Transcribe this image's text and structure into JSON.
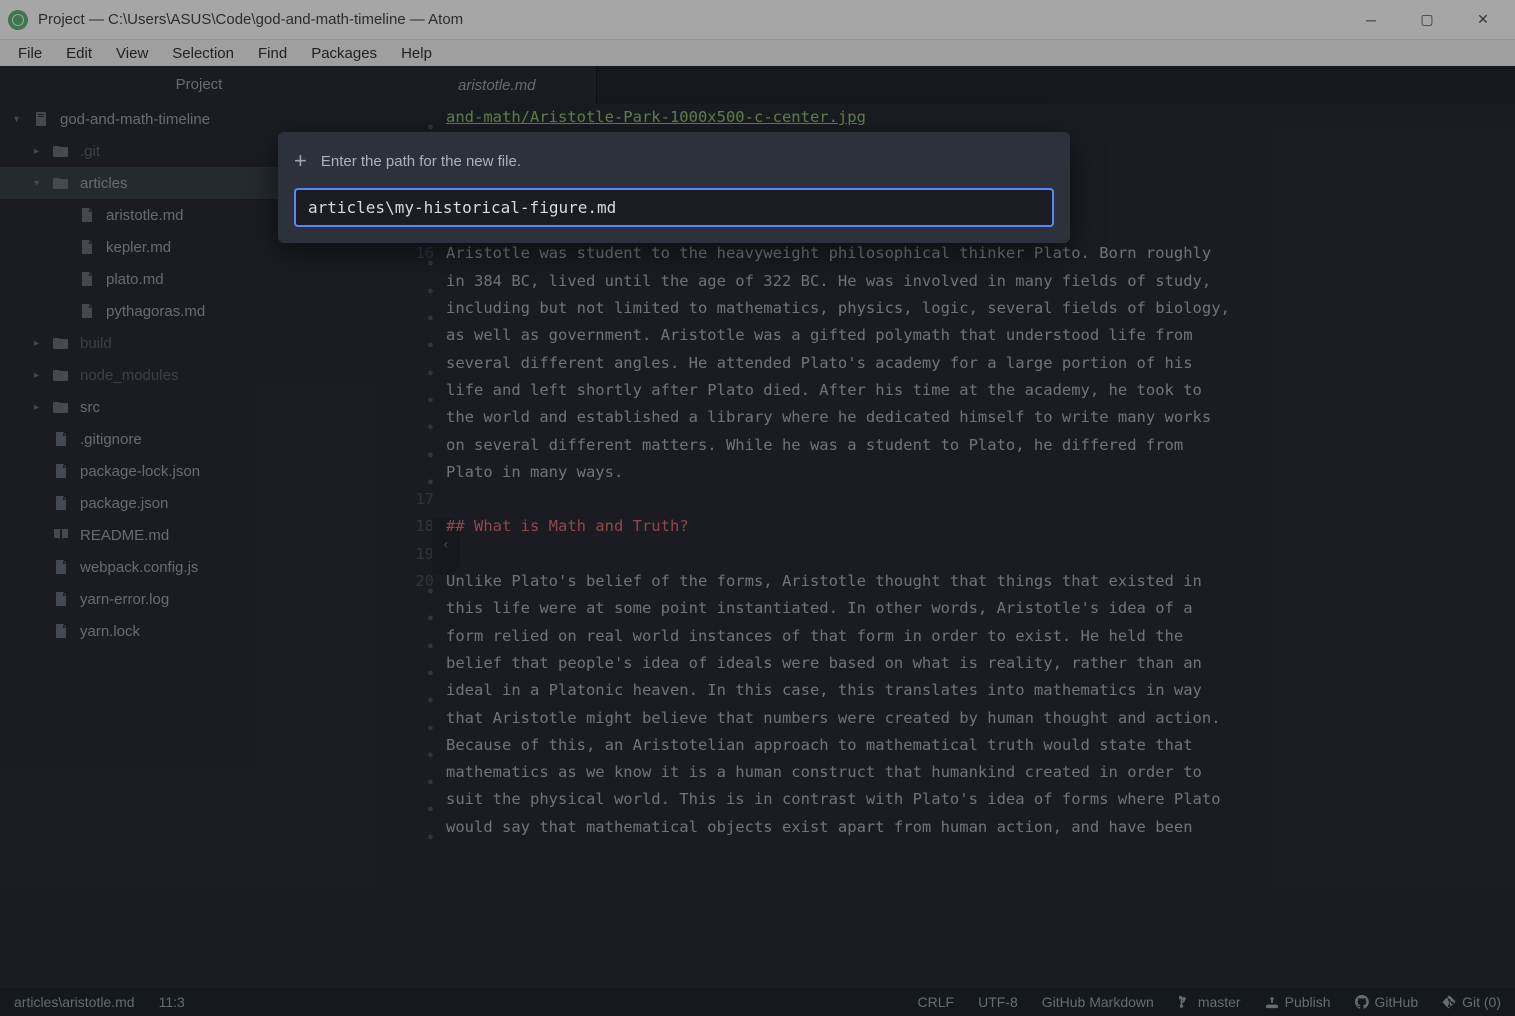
{
  "window": {
    "title": "Project — C:\\Users\\ASUS\\Code\\god-and-math-timeline — Atom"
  },
  "menu": [
    "File",
    "Edit",
    "View",
    "Selection",
    "Find",
    "Packages",
    "Help"
  ],
  "sidebar": {
    "title": "Project",
    "root": "god-and-math-timeline",
    "items": [
      {
        "type": "folder",
        "name": ".git",
        "depth": 1,
        "expanded": false,
        "dim": true
      },
      {
        "type": "folder",
        "name": "articles",
        "depth": 1,
        "expanded": true,
        "selected": true
      },
      {
        "type": "file",
        "name": "aristotle.md",
        "depth": 2
      },
      {
        "type": "file",
        "name": "kepler.md",
        "depth": 2
      },
      {
        "type": "file",
        "name": "plato.md",
        "depth": 2
      },
      {
        "type": "file",
        "name": "pythagoras.md",
        "depth": 2
      },
      {
        "type": "folder",
        "name": "build",
        "depth": 1,
        "expanded": false,
        "dim": true
      },
      {
        "type": "folder",
        "name": "node_modules",
        "depth": 1,
        "expanded": false,
        "dim": true
      },
      {
        "type": "folder",
        "name": "src",
        "depth": 1,
        "expanded": false
      },
      {
        "type": "file",
        "name": ".gitignore",
        "depth": 1
      },
      {
        "type": "file",
        "name": "package-lock.json",
        "depth": 1
      },
      {
        "type": "file",
        "name": "package.json",
        "depth": 1
      },
      {
        "type": "readme",
        "name": "README.md",
        "depth": 1
      },
      {
        "type": "file",
        "name": "webpack.config.js",
        "depth": 1
      },
      {
        "type": "file",
        "name": "yarn-error.log",
        "depth": 1
      },
      {
        "type": "file",
        "name": "yarn.lock",
        "depth": 1
      }
    ]
  },
  "editor": {
    "tab": "aristotle.md",
    "lines": [
      {
        "n": "",
        "text": "and-math/Aristotle-Park-1000x500-c-center.jpg",
        "cls": "green-ul",
        "bullet": true
      },
      {
        "n": "",
        "text": "",
        "bullet": false
      },
      {
        "n": "",
        "text": "",
        "bullet": false
      },
      {
        "n": "",
        "text": "",
        "bullet": false
      },
      {
        "n": "",
        "text": "",
        "bullet": false
      },
      {
        "n": "16",
        "text": "Aristotle was student to the heavyweight philosophical thinker Plato. Born roughly",
        "bullet": true
      },
      {
        "n": "",
        "text": "in 384 BC, lived until the age of 322 BC. He was involved in many fields of study,",
        "bullet": true
      },
      {
        "n": "",
        "text": "including but not limited to mathematics, physics, logic, several fields of biology,",
        "bullet": true
      },
      {
        "n": "",
        "text": "as well as government. Aristotle was a gifted polymath that understood life from",
        "bullet": true
      },
      {
        "n": "",
        "text": "several different angles. He attended Plato's academy for a large portion of his",
        "bullet": true
      },
      {
        "n": "",
        "text": "life and left shortly after Plato died. After his time at the academy, he took to",
        "bullet": true
      },
      {
        "n": "",
        "text": "the world and established a library where he dedicated himself to write many works",
        "bullet": true
      },
      {
        "n": "",
        "text": "on several different matters. While he was a student to Plato, he differed from",
        "bullet": true
      },
      {
        "n": "",
        "text": "Plato in many ways.",
        "bullet": true
      },
      {
        "n": "17",
        "text": "",
        "bullet": false
      },
      {
        "n": "18",
        "text": "## What is Math and Truth?",
        "cls": "heading",
        "bullet": false
      },
      {
        "n": "19",
        "text": "",
        "bullet": false
      },
      {
        "n": "20",
        "text": "Unlike Plato's belief of the forms, Aristotle thought that things that existed in",
        "bullet": true
      },
      {
        "n": "",
        "text": "this life were at some point instantiated. In other words, Aristotle's idea of a",
        "bullet": true
      },
      {
        "n": "",
        "text": "form relied on real world instances of that form in order to exist. He held the",
        "bullet": true
      },
      {
        "n": "",
        "text": "belief that people's idea of ideals were based on what is reality, rather than an",
        "bullet": true
      },
      {
        "n": "",
        "text": "ideal in a Platonic heaven. In this case, this translates into mathematics in way",
        "bullet": true
      },
      {
        "n": "",
        "text": "that Aristotle might believe that numbers were created by human thought and action.",
        "bullet": true
      },
      {
        "n": "",
        "text": "Because of this, an Aristotelian approach to mathematical truth would state that",
        "bullet": true
      },
      {
        "n": "",
        "text": "mathematics as we know it is a human construct that humankind created in order to",
        "bullet": true
      },
      {
        "n": "",
        "text": "suit the physical world. This is in contrast with Plato's idea of forms where Plato",
        "bullet": true
      },
      {
        "n": "",
        "text": "would say that mathematical objects exist apart from human action, and have been",
        "bullet": true
      }
    ]
  },
  "modal": {
    "prompt": "Enter the path for the new file.",
    "value": "articles\\my-historical-figure.md"
  },
  "status": {
    "path": "articles\\aristotle.md",
    "cursor": "11:3",
    "eol": "CRLF",
    "encoding": "UTF-8",
    "grammar": "GitHub Markdown",
    "branch": "master",
    "publish": "Publish",
    "github": "GitHub",
    "git": "Git (0)"
  }
}
